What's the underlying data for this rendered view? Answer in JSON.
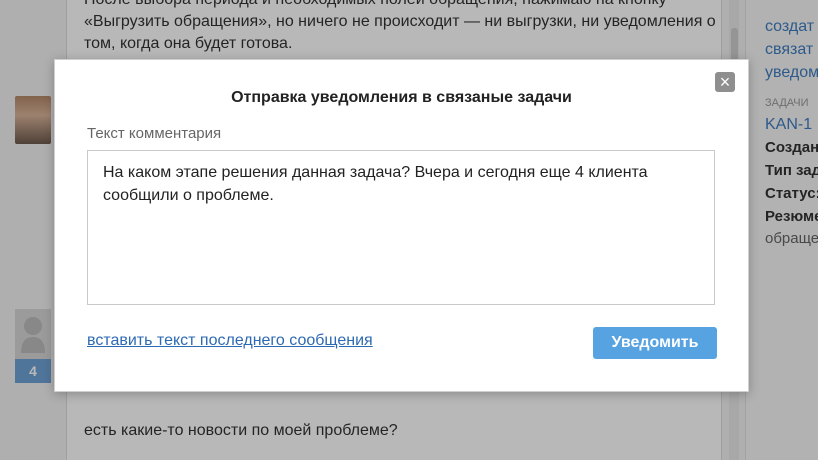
{
  "background": {
    "message_top": "После выбора периода и необходимых полей обращения, нажимаю на кнопку «Выгрузить обращения», но ничего не происходит — ни выгрузки, ни уведомления о том, когда она будет готова.",
    "message_bottom": "есть какие-то новости по моей проблеме?",
    "badge_count": "4",
    "sidebar": {
      "link_lines": [
        "создат",
        "связат",
        "уведом"
      ],
      "tasks_label": "ЗАДАЧИ",
      "task_id": "KAN-1",
      "created_label": "Создан",
      "type_label": "Тип зад",
      "status_label": "Статус:",
      "summary_label": "Резюме",
      "summary_value": "обращен"
    }
  },
  "modal": {
    "title": "Отправка уведомления в связаные задачи",
    "comment_label": "Текст комментария",
    "comment_value": "На каком этапе решения данная задача? Вчера и сегодня еще 4 клиента сообщили о проблеме.",
    "insert_link": "вставить текст последнего сообщения",
    "notify_button": "Уведомить",
    "close_symbol": "×"
  },
  "colors": {
    "accent": "#57a2e0",
    "link": "#2d6ab3",
    "sidebar_link": "#3f7dc0"
  }
}
